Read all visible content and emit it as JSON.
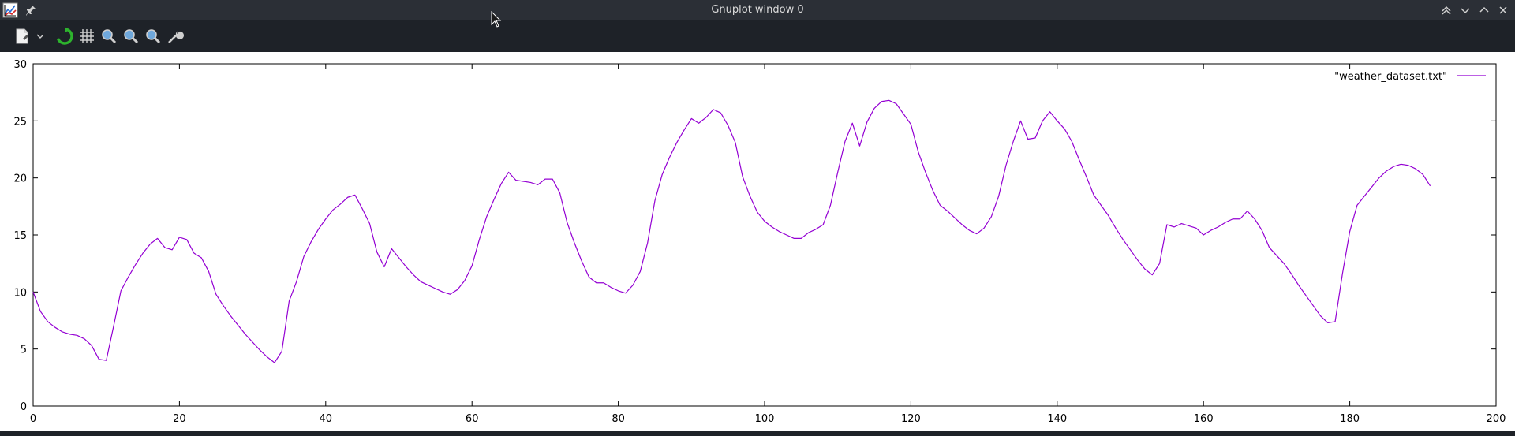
{
  "window": {
    "title": "Gnuplot window 0"
  },
  "titlebar_icons": {
    "app": "gnuplot-app-icon",
    "pin": "pin-icon",
    "controls": [
      "keep-above-icon",
      "minimize-icon",
      "maximize-icon",
      "close-icon"
    ]
  },
  "toolbar": {
    "items": [
      "export-icon",
      "export-menu-chevron-icon",
      "replot-icon",
      "grid-icon",
      "previous-zoom-icon",
      "next-zoom-icon",
      "autoscale-icon",
      "settings-icon"
    ]
  },
  "colors": {
    "titlebar_bg": "#2b2f36",
    "toolbar_bg": "#1e2228",
    "series_line": "#9400d3",
    "plot_bg": "#ffffff",
    "axis": "#000000"
  },
  "chart_data": {
    "type": "line",
    "title": "",
    "xlabel": "",
    "ylabel": "",
    "xlim": [
      0,
      200
    ],
    "ylim": [
      0,
      30
    ],
    "xticks": [
      "0",
      "20",
      "40",
      "60",
      "80",
      "100",
      "120",
      "140",
      "160",
      "180",
      "200"
    ],
    "yticks": [
      "0",
      "5",
      "10",
      "15",
      "20",
      "25",
      "30"
    ],
    "grid": false,
    "legend_position": "top-right",
    "series": [
      {
        "name": "\"weather_dataset.txt\"",
        "color": "#9400d3",
        "x": [
          0,
          1,
          2,
          3,
          4,
          5,
          6,
          7,
          8,
          9,
          10,
          11,
          12,
          13,
          14,
          15,
          16,
          17,
          18,
          19,
          20,
          21,
          22,
          23,
          24,
          25,
          26,
          27,
          28,
          29,
          30,
          31,
          32,
          33,
          34,
          35,
          36,
          37,
          38,
          39,
          40,
          41,
          42,
          43,
          44,
          45,
          46,
          47,
          48,
          49,
          50,
          51,
          52,
          53,
          54,
          55,
          56,
          57,
          58,
          59,
          60,
          61,
          62,
          63,
          64,
          65,
          66,
          67,
          68,
          69,
          70,
          71,
          72,
          73,
          74,
          75,
          76,
          77,
          78,
          79,
          80,
          81,
          82,
          83,
          84,
          85,
          86,
          87,
          88,
          89,
          90,
          91,
          92,
          93,
          94,
          95,
          96,
          97,
          98,
          99,
          100,
          101,
          102,
          103,
          104,
          105,
          106,
          107,
          108,
          109,
          110,
          111,
          112,
          113,
          114,
          115,
          116,
          117,
          118,
          119,
          120,
          121,
          122,
          123,
          124,
          125,
          126,
          127,
          128,
          129,
          130,
          131,
          132,
          133,
          134,
          135,
          136,
          137,
          138,
          139,
          140,
          141,
          142,
          143,
          144,
          145,
          146,
          147,
          148,
          149,
          150,
          151,
          152,
          153,
          154,
          155,
          156,
          157,
          158,
          159,
          160,
          161,
          162,
          163,
          164,
          165,
          166,
          167,
          168,
          169,
          170,
          171,
          172,
          173,
          174,
          175,
          176,
          177,
          178,
          179,
          180,
          181,
          182,
          183,
          184,
          185,
          186,
          187,
          188,
          189,
          190,
          191
        ],
        "y": [
          10.0,
          8.3,
          7.4,
          6.9,
          6.5,
          6.3,
          6.2,
          5.9,
          5.3,
          4.1,
          4.0,
          7.0,
          10.1,
          11.3,
          12.4,
          13.4,
          14.2,
          14.7,
          13.9,
          13.7,
          14.8,
          14.6,
          13.4,
          13.0,
          11.8,
          9.8,
          8.8,
          7.9,
          7.1,
          6.3,
          5.6,
          4.9,
          4.3,
          3.8,
          4.8,
          9.2,
          10.9,
          13.1,
          14.4,
          15.5,
          16.4,
          17.2,
          17.7,
          18.3,
          18.5,
          17.3,
          16.0,
          13.5,
          12.2,
          13.8,
          13.0,
          12.2,
          11.5,
          10.9,
          10.6,
          10.3,
          10.0,
          9.8,
          10.2,
          11.0,
          12.3,
          14.6,
          16.6,
          18.1,
          19.5,
          20.5,
          19.8,
          19.7,
          19.6,
          19.4,
          19.9,
          19.9,
          18.7,
          16.1,
          14.3,
          12.7,
          11.3,
          10.8,
          10.8,
          10.4,
          10.1,
          9.9,
          10.6,
          11.8,
          14.3,
          18.0,
          20.3,
          21.8,
          23.1,
          24.2,
          25.2,
          24.8,
          25.3,
          26.0,
          25.7,
          24.6,
          23.1,
          20.1,
          18.4,
          17.0,
          16.2,
          15.7,
          15.3,
          15.0,
          14.7,
          14.7,
          15.2,
          15.5,
          15.9,
          17.6,
          20.5,
          23.2,
          24.8,
          22.8,
          24.9,
          26.1,
          26.7,
          26.8,
          26.5,
          25.6,
          24.7,
          22.3,
          20.5,
          18.9,
          17.6,
          17.1,
          16.5,
          15.9,
          15.4,
          15.1,
          15.6,
          16.6,
          18.4,
          21.1,
          23.2,
          25.0,
          23.4,
          23.5,
          25.0,
          25.8,
          25.0,
          24.3,
          23.2,
          21.6,
          20.1,
          18.5,
          17.6,
          16.7,
          15.6,
          14.6,
          13.7,
          12.8,
          12.0,
          11.5,
          12.5,
          15.9,
          15.7,
          16.0,
          15.8,
          15.6,
          15.0,
          15.4,
          15.7,
          16.1,
          16.4,
          16.4,
          17.1,
          16.4,
          15.4,
          13.9,
          13.2,
          12.5,
          11.6,
          10.6,
          9.7,
          8.8,
          7.9,
          7.3,
          7.4,
          11.6,
          15.3,
          17.6,
          18.4,
          19.2,
          20.0,
          20.6,
          21.0,
          21.2,
          21.1,
          20.8,
          20.3,
          19.3
        ]
      }
    ]
  }
}
